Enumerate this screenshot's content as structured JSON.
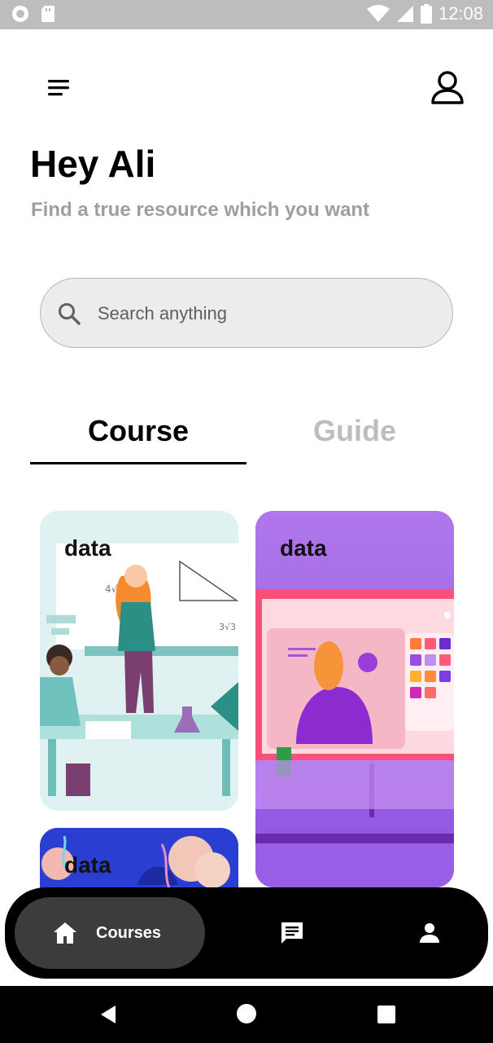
{
  "status_bar": {
    "time": "12:08"
  },
  "header": {
    "greeting": "Hey Ali",
    "subtitle": "Find a true resource which you want"
  },
  "search": {
    "placeholder": "Search anything",
    "value": ""
  },
  "tabs": [
    {
      "label": "Course",
      "active": true
    },
    {
      "label": "Guide",
      "active": false
    }
  ],
  "cards": [
    {
      "label": "data"
    },
    {
      "label": "data"
    },
    {
      "label": "data"
    }
  ],
  "bottom_nav": {
    "items": [
      {
        "label": "Courses",
        "icon": "home-icon",
        "active": true
      },
      {
        "icon": "chat-icon",
        "active": false
      },
      {
        "icon": "person-icon",
        "active": false
      }
    ]
  },
  "colors": {
    "text_primary": "#000000",
    "text_muted": "#9e9e9e",
    "tab_inactive": "#bdbdbd",
    "nav_bg": "#000000",
    "nav_active_bg": "#3c3c3c",
    "search_bg": "#ececec"
  }
}
